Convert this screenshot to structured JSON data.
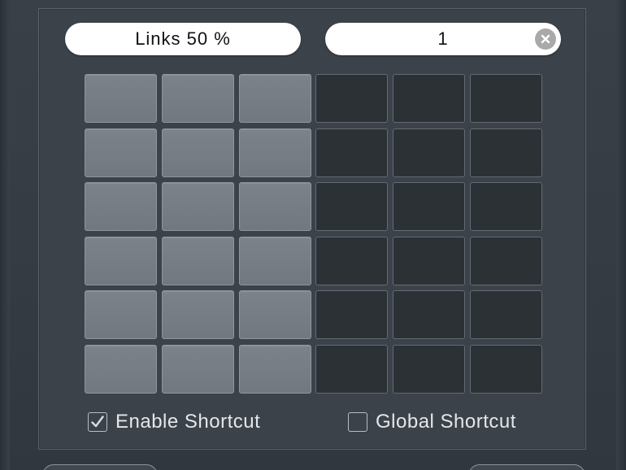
{
  "layout_name_field": {
    "value": "Links 50 %"
  },
  "count_field": {
    "value": "1",
    "clear_icon": "clear-icon"
  },
  "grid": {
    "columns": 6,
    "rows": 6,
    "selected_columns": [
      0,
      1,
      2
    ],
    "colors": {
      "selected": "#777d84",
      "unselected": "#2c3136"
    }
  },
  "options": {
    "enable_shortcut": {
      "label": "Enable Shortcut",
      "checked": true
    },
    "global_shortcut": {
      "label": "Global Shortcut",
      "checked": false
    }
  }
}
